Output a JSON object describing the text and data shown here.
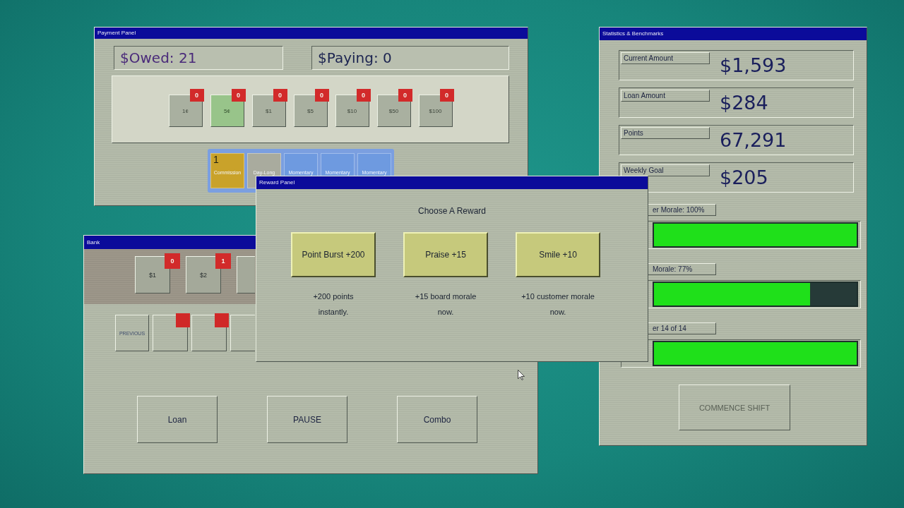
{
  "payment_panel": {
    "title": "Payment Panel",
    "owed": "$Owed: 21",
    "paying": "$Paying: 0",
    "denominations": [
      {
        "label": "1¢",
        "count": "0",
        "selected": false
      },
      {
        "label": "5¢",
        "count": "0",
        "selected": true
      },
      {
        "label": "$1",
        "count": "0",
        "selected": false
      },
      {
        "label": "$5",
        "count": "0",
        "selected": false
      },
      {
        "label": "$10",
        "count": "0",
        "selected": false
      },
      {
        "label": "$50",
        "count": "0",
        "selected": false
      },
      {
        "label": "$100",
        "count": "0",
        "selected": false
      }
    ],
    "tabs": [
      {
        "count": "1",
        "label": "Commission",
        "color": "#c9a22a"
      },
      {
        "label": "Day-Long",
        "color": "#a9ab9e"
      },
      {
        "label": "Momentary",
        "color": "#6e9ae0"
      },
      {
        "label": "Momentary",
        "color": "#6e9ae0"
      },
      {
        "label": "Momentary",
        "color": "#6e9ae0"
      }
    ]
  },
  "statistics": {
    "title": "Statistics & Benchmarks",
    "fields": [
      {
        "label": "Current Amount",
        "value": "$1,593"
      },
      {
        "label": "Loan Amount",
        "value": "$284"
      },
      {
        "label": "Points",
        "value": "67,291"
      },
      {
        "label": "Weekly Goal",
        "value": "$205"
      }
    ],
    "meters": [
      {
        "label": "er Morale: 100%",
        "level": 1.0
      },
      {
        "label": "Morale: 77%",
        "level": 0.77
      },
      {
        "label": "er 14 of 14",
        "level": 1.0
      }
    ],
    "button": {
      "label": "COMMENCE SHIFT",
      "disabled": true
    }
  },
  "bank": {
    "title": "Bank",
    "coins": [
      {
        "label": "$1",
        "count": "0"
      },
      {
        "label": "$2",
        "count": "1"
      }
    ],
    "previous": "PREVIOUS",
    "buttons": [
      "Loan",
      "PAUSE",
      "Combo"
    ]
  },
  "reward_panel": {
    "title": "Reward Panel",
    "heading": "Choose A Reward",
    "options": [
      {
        "label": "Point Burst +200",
        "description": "+200 points\ninstantly."
      },
      {
        "label": "Praise +15",
        "description": "+15 board morale\nnow."
      },
      {
        "label": "Smile +10",
        "description": "+10 customer morale\nnow."
      }
    ]
  }
}
